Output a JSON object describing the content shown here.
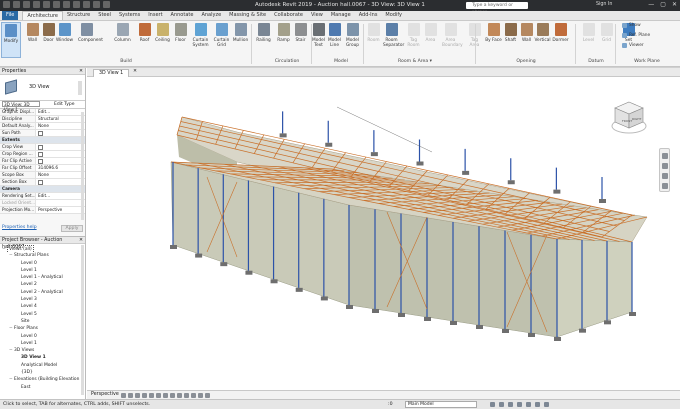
{
  "app": {
    "window_title": "Autodesk Revit 2019 - Auction hall.0067 - 3D View: 3D View 1",
    "search_placeholder": "Type a keyword or phrase",
    "sign_in": "Sign In",
    "window_controls": {
      "minimize": "—",
      "maximize": "▢",
      "close": "✕"
    }
  },
  "tabs": [
    "File",
    "Architecture",
    "Structure",
    "Steel",
    "Systems",
    "Insert",
    "Annotate",
    "Analyze",
    "Massing & Site",
    "Collaborate",
    "View",
    "Manage",
    "Add-Ins",
    "Modify"
  ],
  "active_tab": "Architecture",
  "ribbon": {
    "select_label": "Select ▾",
    "buttons": [
      {
        "label": "Modify",
        "icon": "cursor-icon",
        "selected": true
      },
      {
        "label": "Wall",
        "icon": "wall-icon"
      },
      {
        "label": "Door",
        "icon": "door-icon"
      },
      {
        "label": "Window",
        "icon": "window-icon"
      },
      {
        "label": "Component",
        "icon": "component-icon"
      },
      {
        "label": "Column",
        "icon": "column-icon"
      },
      {
        "label": "Roof",
        "icon": "roof-icon"
      },
      {
        "label": "Ceiling",
        "icon": "ceiling-icon"
      },
      {
        "label": "Floor",
        "icon": "floor-icon"
      },
      {
        "label": "Curtain System",
        "icon": "curtain-system-icon"
      },
      {
        "label": "Curtain Grid",
        "icon": "curtain-grid-icon"
      },
      {
        "label": "Mullion",
        "icon": "mullion-icon"
      },
      {
        "label": "Railing",
        "icon": "railing-icon"
      },
      {
        "label": "Ramp",
        "icon": "ramp-icon"
      },
      {
        "label": "Stair",
        "icon": "stair-icon"
      },
      {
        "label": "Model Text",
        "icon": "model-text-icon"
      },
      {
        "label": "Model Line",
        "icon": "model-line-icon"
      },
      {
        "label": "Model Group",
        "icon": "model-group-icon"
      },
      {
        "label": "Room",
        "icon": "room-icon",
        "dim": true
      },
      {
        "label": "Room Separator",
        "icon": "room-separator-icon"
      },
      {
        "label": "Tag Room",
        "icon": "tag-room-icon",
        "dim": true
      },
      {
        "label": "Area",
        "icon": "area-icon",
        "dim": true
      },
      {
        "label": "Area Boundary",
        "icon": "area-boundary-icon",
        "dim": true
      },
      {
        "label": "Tag Area",
        "icon": "tag-area-icon",
        "dim": true
      },
      {
        "label": "By Face",
        "icon": "by-face-icon"
      },
      {
        "label": "Shaft",
        "icon": "shaft-icon"
      },
      {
        "label": "Wall",
        "icon": "wall-opening-icon"
      },
      {
        "label": "Vertical",
        "icon": "vertical-icon"
      },
      {
        "label": "Dormer",
        "icon": "dormer-icon"
      },
      {
        "label": "Level",
        "icon": "level-icon",
        "dim": true
      },
      {
        "label": "Grid",
        "icon": "grid-icon",
        "dim": true
      },
      {
        "label": "Set",
        "icon": "set-icon"
      }
    ],
    "workplane_small": [
      "Show",
      "Ref. Plane",
      "Viewer"
    ],
    "groups": [
      "Build",
      "Circulation",
      "Model",
      "Room & Area ▾",
      "Opening",
      "Datum",
      "Work Plane"
    ]
  },
  "properties": {
    "header": "Properties",
    "close": "✕",
    "type_name": "3D View",
    "view_selector": "3D View: 3D View 1",
    "edit_type": "Edit Type",
    "rows": [
      {
        "k": "Graphic Displ...",
        "v": "Edit..."
      },
      {
        "k": "Discipline",
        "v": "Structural"
      },
      {
        "k": "Default Analy...",
        "v": "None"
      },
      {
        "k": "Sun Path",
        "v": "",
        "check": true
      },
      {
        "k": "Extents",
        "v": "",
        "section": true
      },
      {
        "k": "Crop View",
        "v": "",
        "check": true
      },
      {
        "k": "Crop Region ...",
        "v": "",
        "check": true
      },
      {
        "k": "Far Clip Active",
        "v": "",
        "check": true
      },
      {
        "k": "Far Clip Offset",
        "v": "314096.6"
      },
      {
        "k": "Scope Box",
        "v": "None"
      },
      {
        "k": "Section Box",
        "v": "",
        "check": true
      },
      {
        "k": "Camera",
        "v": "",
        "section": true
      },
      {
        "k": "Rendering Set...",
        "v": "Edit..."
      },
      {
        "k": "Locked Orient...",
        "v": "",
        "grey": true
      },
      {
        "k": "Projection Mo...",
        "v": "Perspective"
      }
    ],
    "help_link": "Properties help",
    "apply": "Apply"
  },
  "project_browser": {
    "header": "Project Browser - Auction hall.0067",
    "close": "✕",
    "items": [
      {
        "label": "Views (all)",
        "level": 0,
        "toggle": "−",
        "boxed": true
      },
      {
        "label": "Structural Plans",
        "level": 1,
        "toggle": "−"
      },
      {
        "label": "Level 0",
        "level": 2
      },
      {
        "label": "Level 1",
        "level": 2
      },
      {
        "label": "Level 1 - Analytical",
        "level": 2
      },
      {
        "label": "Level 2",
        "level": 2
      },
      {
        "label": "Level 2 - Analytical",
        "level": 2
      },
      {
        "label": "Level 3",
        "level": 2
      },
      {
        "label": "Level 4",
        "level": 2
      },
      {
        "label": "Level 5",
        "level": 2
      },
      {
        "label": "Site",
        "level": 2
      },
      {
        "label": "Floor Plans",
        "level": 1,
        "toggle": "−"
      },
      {
        "label": "Level 0",
        "level": 2
      },
      {
        "label": "Level 1",
        "level": 2
      },
      {
        "label": "3D Views",
        "level": 1,
        "toggle": "−"
      },
      {
        "label": "3D View 1",
        "level": 2,
        "bold": true
      },
      {
        "label": "Analytical Model",
        "level": 2
      },
      {
        "label": "{3D}",
        "level": 2
      },
      {
        "label": "Elevations (Building Elevation",
        "level": 1,
        "toggle": "−"
      },
      {
        "label": "East",
        "level": 2
      }
    ]
  },
  "view": {
    "tab_label": "3D View 1",
    "tab_close": "✕",
    "viewcube_labels": [
      "FRONT",
      "RIGHT"
    ],
    "view_control_label": "Perspective"
  },
  "status": {
    "message": "Click to select, TAB for alternates, CTRL adds, SHIFT unselects.",
    "zero": ":0",
    "model": "Main Model"
  },
  "colors": {
    "titlebar": "#2b2d30",
    "file_tab": "#2a6aa5",
    "truss_orange": "#c9702a",
    "column_blue": "#2c52a8",
    "wall_grey": "#c9cab8",
    "roof_grey": "#d9d6c8",
    "footing_grey": "#6e6e6e"
  }
}
